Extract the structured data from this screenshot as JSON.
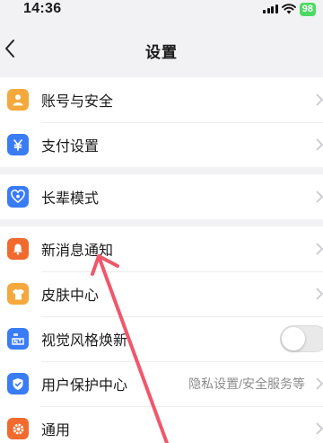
{
  "status_bar": {
    "time": "14:36",
    "battery": "98"
  },
  "nav": {
    "title": "设置"
  },
  "groups": [
    [
      {
        "label": "账号与安全",
        "icon": "user-icon",
        "color": "#f5a83b"
      },
      {
        "label": "支付设置",
        "icon": "yen-icon",
        "color": "#3a7bf6"
      }
    ],
    [
      {
        "label": "长辈模式",
        "icon": "heart-mode-icon",
        "color": "#3a7bf6"
      }
    ],
    [
      {
        "label": "新消息通知",
        "icon": "bell-icon",
        "color": "#f26a2e"
      },
      {
        "label": "皮肤中心",
        "icon": "shirt-icon",
        "color": "#f5a83b"
      },
      {
        "label": "视觉风格焕新",
        "icon": "new-style-icon",
        "color": "#3a7bf6",
        "toggle": false
      },
      {
        "label": "用户保护中心",
        "icon": "shield-icon",
        "color": "#3a7bf6",
        "value": "隐私设置/安全服务等"
      },
      {
        "label": "通用",
        "icon": "gear-icon",
        "color": "#f26a2e"
      }
    ]
  ],
  "annotation_color": "#f0576b"
}
